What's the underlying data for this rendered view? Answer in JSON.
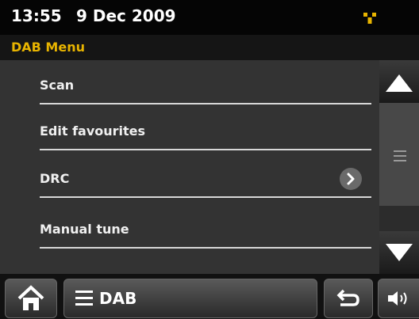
{
  "status": {
    "time": "13:55",
    "date": "9 Dec 2009",
    "signal_icon": "signal-icon",
    "signal_color": "#e8b400"
  },
  "title": "DAB Menu",
  "title_color": "#e8b400",
  "menu": {
    "items": [
      {
        "label": "Scan"
      },
      {
        "label": "Edit favourites"
      },
      {
        "label": "DRC",
        "has_submenu": true
      },
      {
        "label": "Manual tune"
      }
    ]
  },
  "bottom": {
    "source_label": "DAB",
    "icons": [
      "home-icon",
      "menu-lines-icon",
      "back-arrow-icon",
      "volume-icon"
    ]
  }
}
